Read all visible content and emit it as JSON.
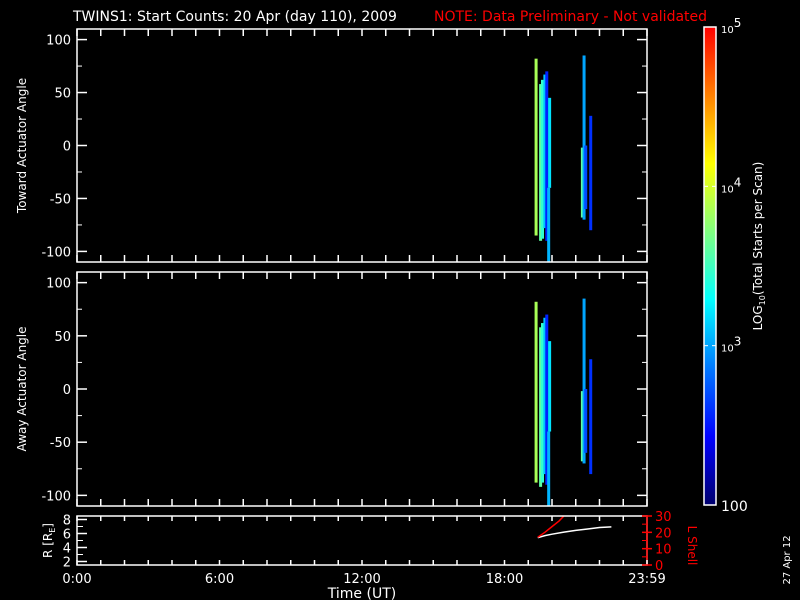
{
  "chart_data": {
    "type": "heatmap",
    "title": "TWINS1: Start Counts: 20 Apr (day 110), 2009",
    "note": "NOTE: Data Preliminary - Not validated",
    "xlabel": "Time (UT)",
    "x_ticks": [
      "0:00",
      "6:00",
      "12:00",
      "18:00",
      "23:59"
    ],
    "x_tick_hours": [
      0,
      6,
      12,
      18,
      24
    ],
    "xlim_hours": [
      0,
      24
    ],
    "stamp": "27 Apr 12",
    "colorbar": {
      "label": "LOG10(Total Starts per Scan)",
      "label_main": "LOG",
      "label_sub": "10",
      "label_rest": "(Total Starts per Scan)",
      "ticks": [
        {
          "base": "10",
          "exp": "5",
          "log": 5
        },
        {
          "base": "10",
          "exp": "4",
          "log": 4
        },
        {
          "base": "10",
          "exp": "3",
          "log": 3
        },
        {
          "base": "100",
          "exp": "",
          "log": 2
        }
      ],
      "range_log": [
        2,
        5
      ],
      "colors": [
        "#00006e",
        "#0000ff",
        "#0078ff",
        "#00ffff",
        "#80ff80",
        "#ffff00",
        "#ff8000",
        "#ff0000"
      ]
    },
    "panels": [
      {
        "ylabel": "Toward Actuator Angle",
        "ylim": [
          -110,
          110
        ],
        "y_ticks": [
          100,
          50,
          0,
          -50,
          -100
        ],
        "stripes": [
          {
            "t": 19.33,
            "from": -85,
            "to": 82,
            "log": 3.85
          },
          {
            "t": 19.52,
            "from": -90,
            "to": 58,
            "log": 3.6
          },
          {
            "t": 19.6,
            "from": -88,
            "to": 62,
            "log": 3.45
          },
          {
            "t": 19.7,
            "from": -78,
            "to": 67,
            "log": 3.1
          },
          {
            "t": 19.78,
            "from": -90,
            "to": 70,
            "log": 2.55
          },
          {
            "t": 19.86,
            "from": -110,
            "to": -40,
            "log": 3.05
          },
          {
            "t": 19.9,
            "from": -40,
            "to": 45,
            "log": 3.2
          },
          {
            "t": 21.28,
            "from": -68,
            "to": -2,
            "log": 3.6
          },
          {
            "t": 21.35,
            "from": -70,
            "to": 85,
            "log": 3.0
          },
          {
            "t": 21.42,
            "from": -60,
            "to": 0,
            "log": 2.7
          },
          {
            "t": 21.63,
            "from": -80,
            "to": 28,
            "log": 2.6
          }
        ]
      },
      {
        "ylabel": "Away Actuator Angle",
        "ylim": [
          -110,
          110
        ],
        "y_ticks": [
          100,
          50,
          0,
          -50,
          -100
        ],
        "stripes": [
          {
            "t": 19.33,
            "from": -88,
            "to": 82,
            "log": 3.85
          },
          {
            "t": 19.52,
            "from": -92,
            "to": 58,
            "log": 3.6
          },
          {
            "t": 19.6,
            "from": -88,
            "to": 62,
            "log": 3.45
          },
          {
            "t": 19.7,
            "from": -80,
            "to": 67,
            "log": 3.1
          },
          {
            "t": 19.78,
            "from": -90,
            "to": 70,
            "log": 2.55
          },
          {
            "t": 19.86,
            "from": -110,
            "to": -40,
            "log": 3.05
          },
          {
            "t": 19.9,
            "from": -40,
            "to": 45,
            "log": 3.2
          },
          {
            "t": 21.28,
            "from": -68,
            "to": -2,
            "log": 3.6
          },
          {
            "t": 21.35,
            "from": -70,
            "to": 85,
            "log": 3.0
          },
          {
            "t": 21.42,
            "from": -60,
            "to": 0,
            "log": 2.7
          },
          {
            "t": 21.63,
            "from": -80,
            "to": 28,
            "log": 2.6
          }
        ]
      }
    ],
    "orbit_panel": {
      "ylabel_left": "R [RE]",
      "ylabel_left_main": "R [R",
      "ylabel_left_sub": "E",
      "ylabel_left_end": "]",
      "ylabel_right": "L Shell",
      "left_ylim": [
        1.5,
        8.5
      ],
      "left_ticks": [
        8,
        6,
        4,
        2
      ],
      "right_ylim": [
        0,
        30
      ],
      "right_ticks": [
        30,
        20,
        10,
        0
      ],
      "R_series": {
        "name": "R",
        "color": "#ffffff",
        "x": [
          19.4,
          19.7,
          20.0,
          20.5,
          21.0,
          21.5,
          22.0,
          22.5
        ],
        "y": [
          5.4,
          5.7,
          5.9,
          6.2,
          6.45,
          6.65,
          6.85,
          6.95
        ]
      },
      "L_series": {
        "name": "L Shell",
        "color": "#ff0000",
        "x": [
          19.4,
          19.7,
          20.0,
          20.3,
          20.5
        ],
        "y": [
          17,
          20,
          23.5,
          27,
          30
        ]
      }
    }
  }
}
